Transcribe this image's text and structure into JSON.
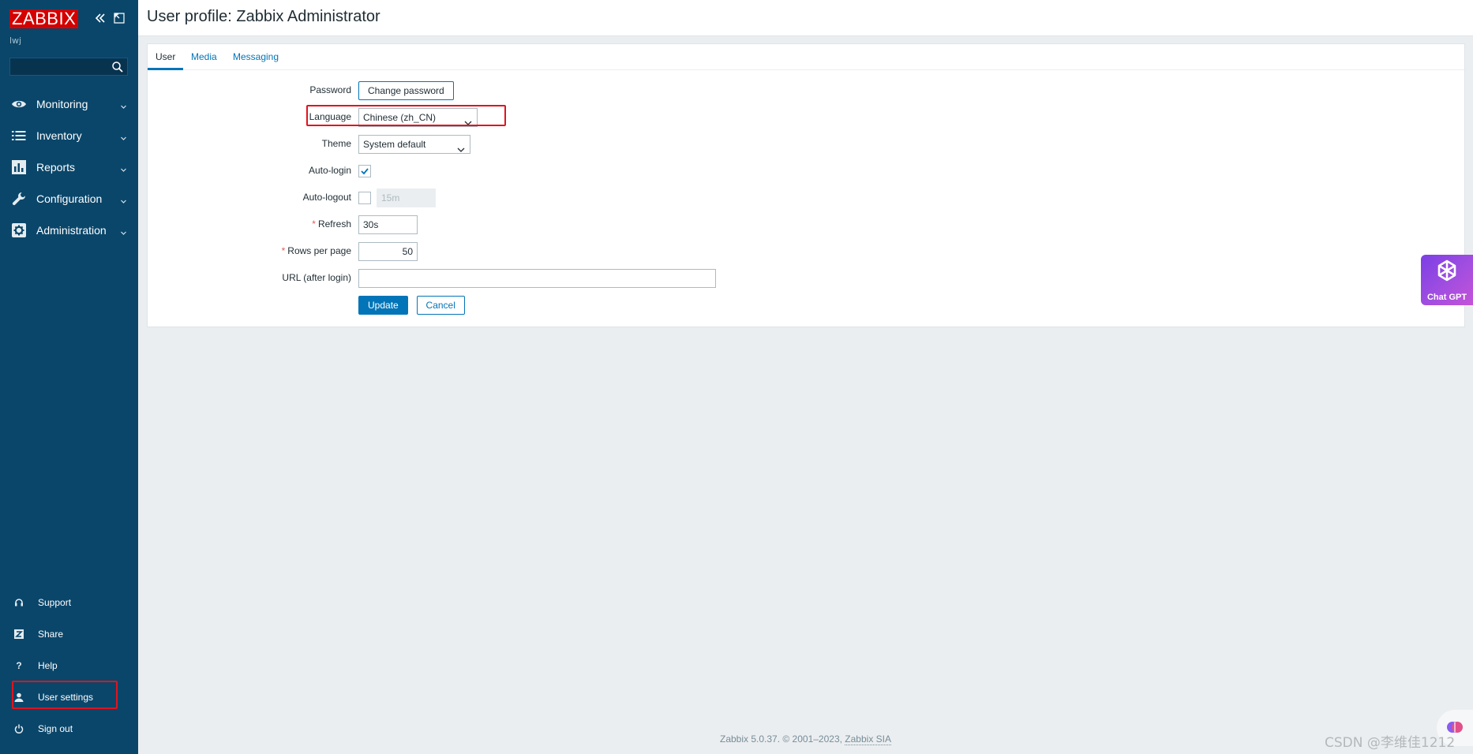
{
  "sidebar": {
    "logo": "ZABBIX",
    "server_name": "lwj",
    "search_placeholder": "",
    "menu": [
      {
        "label": "Monitoring",
        "icon": "eye-icon"
      },
      {
        "label": "Inventory",
        "icon": "list-icon"
      },
      {
        "label": "Reports",
        "icon": "bar-chart-icon"
      },
      {
        "label": "Configuration",
        "icon": "wrench-icon"
      },
      {
        "label": "Administration",
        "icon": "gear-icon"
      }
    ],
    "bottom": [
      {
        "label": "Support",
        "icon": "headset-icon"
      },
      {
        "label": "Share",
        "icon": "share-z-icon"
      },
      {
        "label": "Help",
        "icon": "question-icon"
      },
      {
        "label": "User settings",
        "icon": "user-icon"
      },
      {
        "label": "Sign out",
        "icon": "power-icon"
      }
    ]
  },
  "header": {
    "title": "User profile: Zabbix Administrator"
  },
  "tabs": [
    {
      "label": "User",
      "active": true
    },
    {
      "label": "Media",
      "active": false
    },
    {
      "label": "Messaging",
      "active": false
    }
  ],
  "form": {
    "password_label": "Password",
    "change_password_button": "Change password",
    "language_label": "Language",
    "language_value": "Chinese (zh_CN)",
    "theme_label": "Theme",
    "theme_value": "System default",
    "autologin_label": "Auto-login",
    "autologin_checked": true,
    "autologout_label": "Auto-logout",
    "autologout_checked": false,
    "autologout_value": "15m",
    "refresh_label": "Refresh",
    "refresh_value": "30s",
    "rows_label": "Rows per page",
    "rows_value": "50",
    "url_label": "URL (after login)",
    "url_value": "",
    "required_mark": "*",
    "update_button": "Update",
    "cancel_button": "Cancel"
  },
  "footer": {
    "text": "Zabbix 5.0.37. © 2001–2023, ",
    "link": "Zabbix SIA"
  },
  "overlay": {
    "chatgpt_label": "Chat GPT",
    "watermark": "CSDN @李维佳1212"
  },
  "colors": {
    "sidebar_bg": "#0a466a",
    "logo_red": "#d40000",
    "accent_blue": "#0275b8",
    "highlight_red": "#e0141e"
  }
}
